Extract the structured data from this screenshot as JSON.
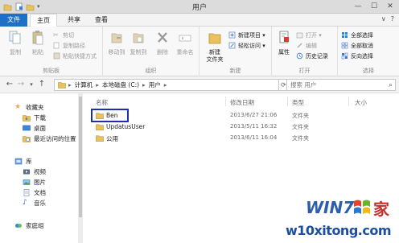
{
  "window": {
    "title": "用户",
    "controls": {
      "minimize": "—",
      "maximize": "☐",
      "close": "✕"
    }
  },
  "tabs": {
    "file": "文件",
    "home": "主页",
    "share": "共享",
    "view": "查看",
    "help": "?"
  },
  "ribbon": {
    "clipboard": {
      "label": "剪贴板",
      "copy": "复制",
      "paste": "粘贴",
      "cut": "剪切",
      "copy_path": "复制路径",
      "paste_shortcut": "粘贴快捷方式"
    },
    "organize": {
      "label": "组织",
      "move_to": "移动到",
      "copy_to": "复制到",
      "delete": "删除",
      "rename": "重命名"
    },
    "new": {
      "label": "新建",
      "new_folder": "新建\n文件夹",
      "new_item": "新建项目 ▾",
      "easy_access": "轻松访问 ▾"
    },
    "open": {
      "label": "打开",
      "properties": "属性",
      "open": "打开 ▾",
      "edit": "编辑",
      "history": "历史记录"
    },
    "select": {
      "label": "选择",
      "select_all": "全部选择",
      "select_none": "全部取消",
      "invert": "反向选择"
    }
  },
  "address": {
    "back": "←",
    "forward": "→",
    "recent": "▾",
    "up": "↑",
    "crumbs": [
      "计算机",
      "本地磁盘 (C:)",
      "用户"
    ],
    "separator": "▸",
    "dropdown": "▾",
    "refresh": "⟳",
    "search_placeholder": "搜索 用户",
    "search_icon": "🔍"
  },
  "sidebar": {
    "favorites": "收藏夹",
    "downloads": "下载",
    "desktop": "桌面",
    "recent": "最近访问的位置",
    "libraries": "库",
    "videos": "视频",
    "pictures": "图片",
    "documents": "文档",
    "music": "音乐",
    "homegroup": "家庭组"
  },
  "columns": {
    "name": "名称",
    "date": "修改日期",
    "type": "类型",
    "size": "大小"
  },
  "files": [
    {
      "name": "Ben",
      "date": "2013/6/27 21:06",
      "type": "文件夹"
    },
    {
      "name": "UpdatusUser",
      "date": "2013/5/11 16:32",
      "type": "文件夹"
    },
    {
      "name": "公用",
      "date": "2013/6/11 16:04",
      "type": "文件夹"
    }
  ],
  "watermark": {
    "logo_text": "WIN7",
    "logo_suffix": "家",
    "url": "w10xitong.com"
  },
  "colors": {
    "file_tab": "#1f6fc4",
    "selection_box": "#1b2fb5",
    "folder": "#e8c160"
  }
}
